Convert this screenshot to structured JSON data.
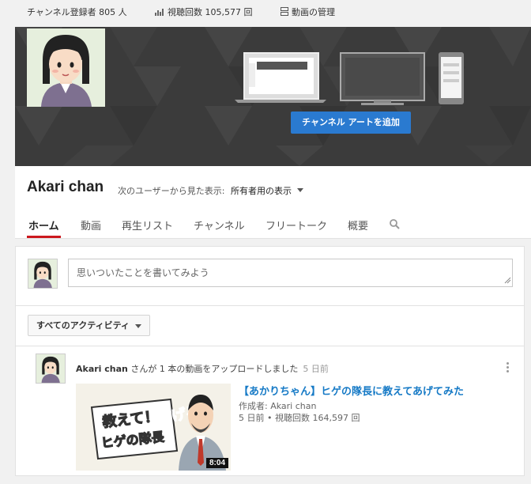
{
  "topbar": {
    "subscribers": "チャンネル登録者 805 人",
    "views_label": "視聴回数 105,577 回",
    "manage_videos": "動画の管理"
  },
  "banner": {
    "add_art_label": "チャンネル アートを追加"
  },
  "channel": {
    "name": "Akari chan",
    "view_as_label": "次のユーザーから見た表示:",
    "view_as_value": "所有者用の表示"
  },
  "tabs": [
    {
      "label": "ホーム",
      "active": true
    },
    {
      "label": "動画"
    },
    {
      "label": "再生リスト"
    },
    {
      "label": "チャンネル"
    },
    {
      "label": "フリートーク"
    },
    {
      "label": "概要"
    }
  ],
  "post": {
    "placeholder": "思いついたことを書いてみよう"
  },
  "activity_filter": {
    "label": "すべてのアクティビティ"
  },
  "feed": {
    "author": "Akari chan",
    "action": " さんが 1 本の動画をアップロードしました",
    "time": "5 日前",
    "video": {
      "title": "【あかりちゃん】ヒゲの隊長に教えてあげてみた",
      "author_line": "作成者: Akari chan",
      "meta_line": "5 日前 • 視聴回数 164,597 回",
      "duration": "8:04",
      "thumb_text_1": "教えて！",
      "thumb_text_2": "ヒゲの隊長",
      "thumb_text_3": "あげる"
    }
  },
  "colors": {
    "accent_red": "#cc181e",
    "link_blue": "#167ac6",
    "button_blue": "#2a7ad0",
    "banner_bg": "#3b3b3b"
  }
}
